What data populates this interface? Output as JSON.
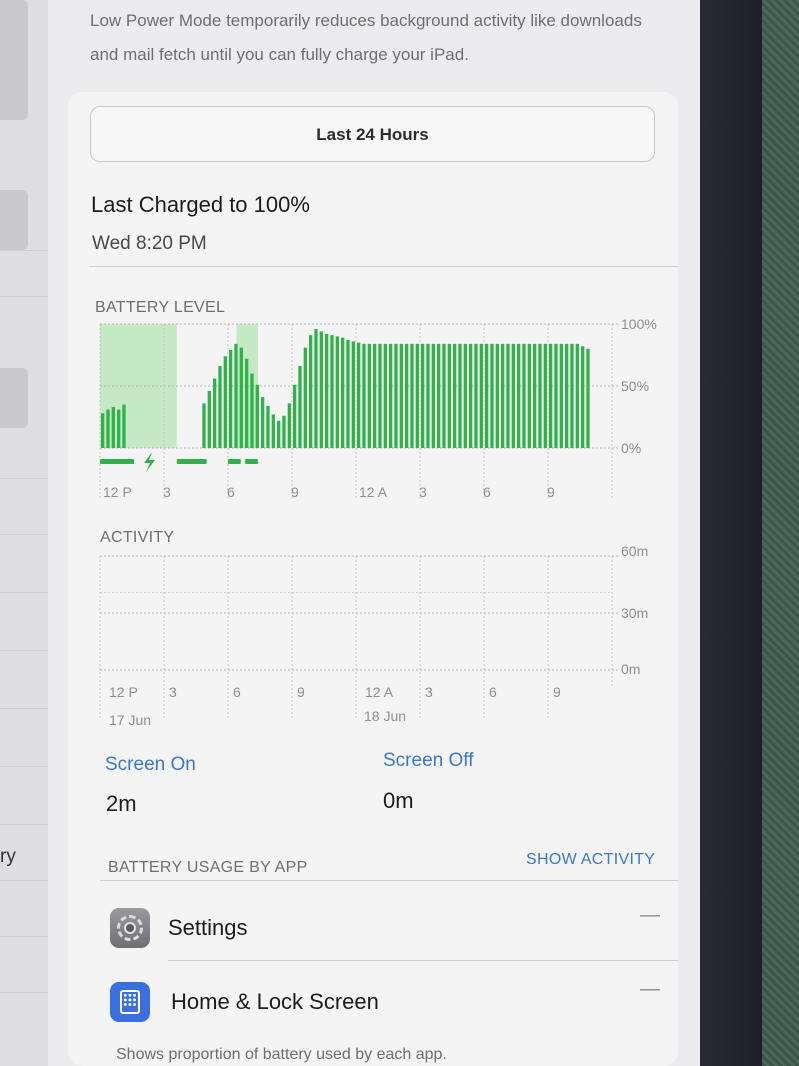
{
  "sidebar": {
    "partial_label": "ry"
  },
  "intro": "Low Power Mode temporarily reduces background activity like downloads and mail fetch until you can fully charge your iPad.",
  "segment": {
    "label": "Last 24 Hours"
  },
  "last_charged": {
    "title": "Last Charged to 100%",
    "time": "Wed 8:20 PM"
  },
  "battery_section": {
    "label": "BATTERY LEVEL"
  },
  "activity_section": {
    "label": "ACTIVITY"
  },
  "axis": {
    "battery_y_labels": [
      "100%",
      "50%",
      "0%"
    ],
    "activity_y_labels": [
      "60m",
      "30m",
      "0m"
    ],
    "x_labels": [
      "12 P",
      "3",
      "6",
      "9",
      "12 A",
      "3",
      "6",
      "9"
    ],
    "date_labels": [
      "17 Jun",
      "18 Jun"
    ]
  },
  "chart_data": [
    {
      "type": "bar",
      "title": "BATTERY LEVEL",
      "x_unit": "hours since 12 PM, 17 Jun",
      "ylim": [
        0,
        100
      ],
      "x_labels": [
        "12 P",
        "3",
        "6",
        "9",
        "12 A",
        "3",
        "6",
        "9"
      ],
      "x": [
        0.0,
        0.25,
        0.5,
        0.75,
        1.0,
        1.25,
        1.5,
        1.75,
        2.0,
        2.25,
        2.5,
        2.75,
        3.0,
        3.25,
        3.5,
        3.75,
        4.0,
        4.25,
        4.5,
        4.75,
        5.0,
        5.25,
        5.5,
        5.75,
        6.0,
        6.25,
        6.5,
        6.75,
        7.0,
        7.25,
        7.5,
        7.75,
        8.0,
        8.25,
        8.5,
        8.75,
        9.0,
        9.25,
        9.5,
        9.75,
        10.0,
        10.25,
        10.5,
        10.75,
        11.0,
        11.25,
        11.5,
        11.75,
        12.0,
        12.25,
        12.5,
        12.75,
        13.0,
        13.25,
        13.5,
        13.75,
        14.0,
        14.25,
        14.5,
        14.75,
        15.0,
        15.25,
        15.5,
        15.75,
        16.0,
        16.25,
        16.5,
        16.75,
        17.0,
        17.25,
        17.5,
        17.75,
        18.0,
        18.25,
        18.5,
        18.75,
        19.0,
        19.25,
        19.5,
        19.75,
        20.0,
        20.25,
        20.5,
        20.75,
        21.0,
        21.25,
        21.5,
        21.75,
        22.0,
        22.25,
        22.5,
        22.75
      ],
      "values": [
        28,
        31,
        33,
        31,
        35,
        0,
        0,
        0,
        0,
        0,
        0,
        0,
        0,
        0,
        0,
        0,
        0,
        0,
        0,
        36,
        46,
        56,
        66,
        74,
        79,
        84,
        81,
        72,
        60,
        51,
        41,
        34,
        27,
        22,
        26,
        36,
        51,
        66,
        81,
        91,
        96,
        94,
        92,
        91,
        90,
        89,
        87,
        86,
        85,
        84,
        84,
        84,
        84,
        84,
        84,
        84,
        84,
        84,
        84,
        84,
        84,
        84,
        84,
        84,
        84,
        84,
        84,
        84,
        84,
        84,
        84,
        84,
        84,
        84,
        84,
        84,
        84,
        84,
        84,
        84,
        84,
        84,
        84,
        84,
        84,
        84,
        84,
        84,
        84,
        84,
        82,
        80
      ],
      "charging_segments": [
        [
          0.0,
          1.6
        ],
        [
          3.6,
          5.0
        ],
        [
          6.0,
          6.6
        ],
        [
          6.8,
          7.4
        ]
      ],
      "charging_shade": [
        [
          0.0,
          3.6
        ],
        [
          6.4,
          7.4
        ]
      ],
      "color": "#2fb24a"
    },
    {
      "type": "bar",
      "title": "ACTIVITY",
      "x_unit": "hours since 12 PM, 17 Jun",
      "ylim": [
        0,
        60
      ],
      "x_labels": [
        "12 P",
        "3",
        "6",
        "9",
        "12 A",
        "3",
        "6",
        "9"
      ],
      "y_labels": [
        "60m",
        "30m",
        "0m"
      ],
      "series": [
        {
          "name": "Screen On",
          "values": []
        },
        {
          "name": "Screen Off",
          "values": []
        }
      ]
    }
  ],
  "screen_on": {
    "label": "Screen On",
    "value": "2m"
  },
  "screen_off": {
    "label": "Screen Off",
    "value": "0m"
  },
  "usage": {
    "label": "BATTERY USAGE BY APP",
    "show_activity": "SHOW ACTIVITY",
    "apps": [
      {
        "name": "Settings",
        "value": "—",
        "icon": "gear-icon"
      },
      {
        "name": "Home & Lock Screen",
        "value": "—",
        "icon": "home-screen-icon"
      }
    ],
    "footer": "Shows proportion of battery used by each app."
  },
  "colors": {
    "battery_green": "#2fb24a",
    "charge_shade": "#c5e8c5",
    "link_blue": "#3a78c9"
  }
}
